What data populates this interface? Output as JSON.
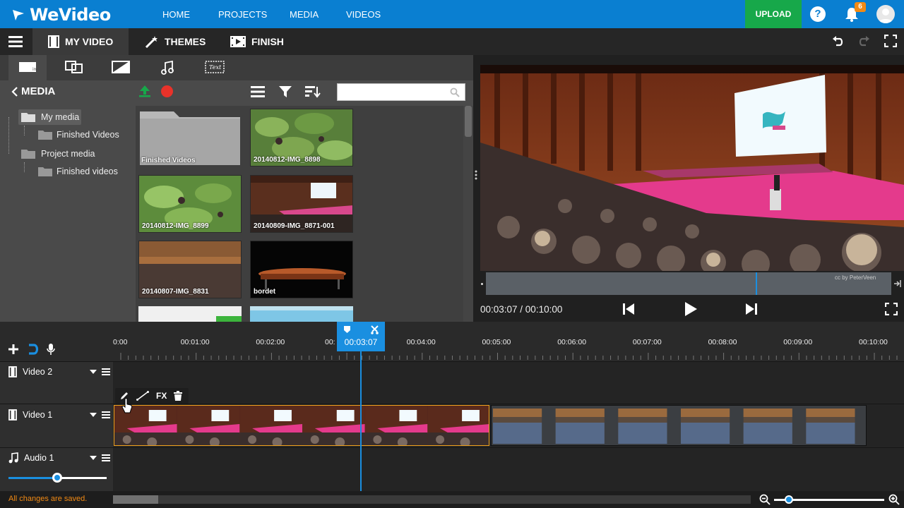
{
  "app": {
    "logo_text": "WeVideo",
    "colors": {
      "brand": "#0a7fd1",
      "upload": "#17a84a",
      "accent": "#f28a14",
      "playhead": "#1a8fe0"
    }
  },
  "topnav": {
    "links": [
      "HOME",
      "PROJECTS",
      "MEDIA",
      "VIDEOS"
    ],
    "upload_label": "UPLOAD",
    "help_label": "?",
    "notifications_count": "6"
  },
  "modebar": {
    "tabs": [
      {
        "label": "MY VIDEO",
        "icon": "film-icon"
      },
      {
        "label": "THEMES",
        "icon": "magic-wand-icon"
      },
      {
        "label": "FINISH",
        "icon": "film-play-icon"
      }
    ]
  },
  "media_tabs": [
    "media-icon",
    "transitions-icon",
    "graphics-icon",
    "music-icon"
  ],
  "media_tab_text_label": "Text",
  "media_tab_active_label": "img",
  "media": {
    "back_label": "MEDIA",
    "tree": [
      {
        "label": "My media",
        "level": 0
      },
      {
        "label": "Finished Videos",
        "level": 1
      },
      {
        "label": "Project media",
        "level": 0
      },
      {
        "label": "Finished videos",
        "level": 1
      }
    ],
    "search_placeholder": "",
    "items": [
      {
        "label": "Finished Videos",
        "kind": "folder"
      },
      {
        "label": "20140812-IMG_8898",
        "kind": "leaves"
      },
      {
        "label": "20140812-IMG_8899",
        "kind": "leaves"
      },
      {
        "label": "20140809-IMG_8871-001",
        "kind": "hall"
      },
      {
        "label": "20140807-IMG_8831",
        "kind": "crowd"
      },
      {
        "label": "bordet",
        "kind": "table"
      },
      {
        "label": "",
        "kind": "white"
      },
      {
        "label": "",
        "kind": "sky"
      }
    ]
  },
  "preview": {
    "timecode": "00:03:07 / 00:10:00",
    "credit": "cc by PeterVeen"
  },
  "timeline": {
    "ticks": [
      "0:00",
      "00:01:00",
      "00:02:00",
      "00:03:00",
      "00:04:00",
      "00:05:00",
      "00:06:00",
      "00:07:00",
      "00:08:00",
      "00:09:00",
      "00:10:00"
    ],
    "playhead_time": "00:03:07",
    "playhead_fraction": 0.312,
    "tracks": [
      {
        "name": "Video 2",
        "icon": "film-icon"
      },
      {
        "name": "Video 1",
        "icon": "film-icon"
      },
      {
        "name": "Audio 1",
        "icon": "music-note-icon"
      }
    ],
    "clip_tools": [
      "pencil-icon",
      "line-icon",
      "FX",
      "trash-icon"
    ],
    "audio_volume": 0.5,
    "zoom_level": 0.1
  },
  "status": {
    "saved_text": "All changes are saved."
  }
}
